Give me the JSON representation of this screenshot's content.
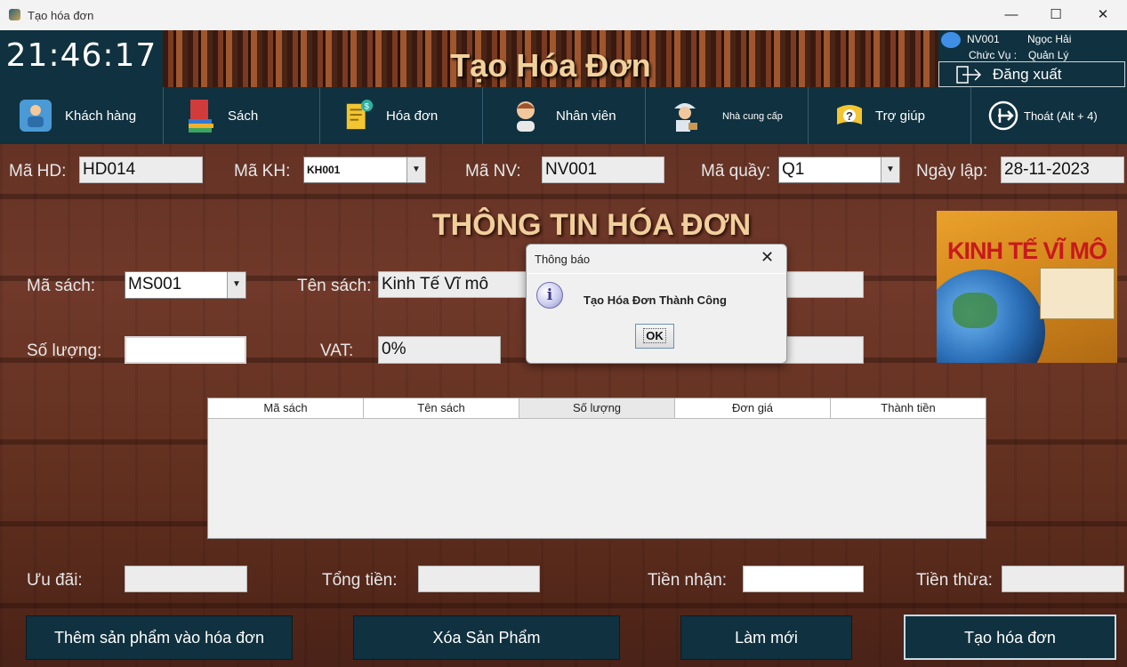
{
  "window": {
    "title": "Tạo hóa đơn",
    "minimize": "—",
    "maximize": "☐",
    "close": "✕"
  },
  "header": {
    "clock": "21:46:17",
    "banner_title": "Tạo Hóa Đơn"
  },
  "user": {
    "id": "NV001",
    "name": "Ngọc Hải",
    "role_label": "Chức Vụ :",
    "role": "Quản Lý",
    "logout_label": "Đăng xuất",
    "logout_icon": "logout-icon"
  },
  "nav": [
    {
      "label": "Khách hàng",
      "icon": "customer-icon"
    },
    {
      "label": "Sách",
      "icon": "books-icon"
    },
    {
      "label": "Hóa đơn",
      "icon": "invoice-icon"
    },
    {
      "label": "Nhân viên",
      "icon": "employee-icon"
    },
    {
      "label": "Nhà cung cấp",
      "icon": "supplier-icon"
    },
    {
      "label": "Trợ giúp",
      "icon": "help-icon"
    },
    {
      "label": "Thoát (Alt + 4)",
      "icon": "exit-icon"
    }
  ],
  "form": {
    "ma_hd_label": "Mã HD:",
    "ma_hd": "HD014",
    "ma_kh_label": "Mã KH:",
    "ma_kh": "KH001",
    "ma_nv_label": "Mã NV:",
    "ma_nv": "NV001",
    "ma_quay_label": "Mã quầy:",
    "ma_quay": "Q1",
    "ngay_lap_label": "Ngày lập:",
    "ngay_lap": "28-11-2023"
  },
  "section_title": "THÔNG TIN HÓA ĐƠN",
  "product": {
    "ma_sach_label": "Mã sách:",
    "ma_sach": "MS001",
    "ten_sach_label": "Tên sách:",
    "ten_sach": "Kinh Tế Vĩ mô",
    "so_luong_label": "Số lượng:",
    "so_luong": "",
    "vat_label": "VAT:",
    "vat": "0%"
  },
  "book_cover": {
    "title": "KINH TẾ VĨ MÔ"
  },
  "table": {
    "columns": [
      "Mã sách",
      "Tên sách",
      "Số lượng",
      "Đơn giá",
      "Thành tiền"
    ],
    "rows": []
  },
  "totals": {
    "uu_dai_label": "Ưu đãi:",
    "uu_dai": "",
    "tong_tien_label": "Tổng tiền:",
    "tong_tien": "",
    "tien_nhan_label": "Tiền nhận:",
    "tien_nhan": "",
    "tien_thua_label": "Tiền thừa:",
    "tien_thua": ""
  },
  "buttons": {
    "add": "Thêm sản phẩm vào hóa đơn",
    "delete": "Xóa Sản Phẩm",
    "refresh": "Làm mới",
    "create": "Tạo hóa đơn"
  },
  "dialog": {
    "title": "Thông báo",
    "close": "✕",
    "icon": "i",
    "message": "Tạo Hóa Đơn Thành Công",
    "ok": "OK"
  }
}
